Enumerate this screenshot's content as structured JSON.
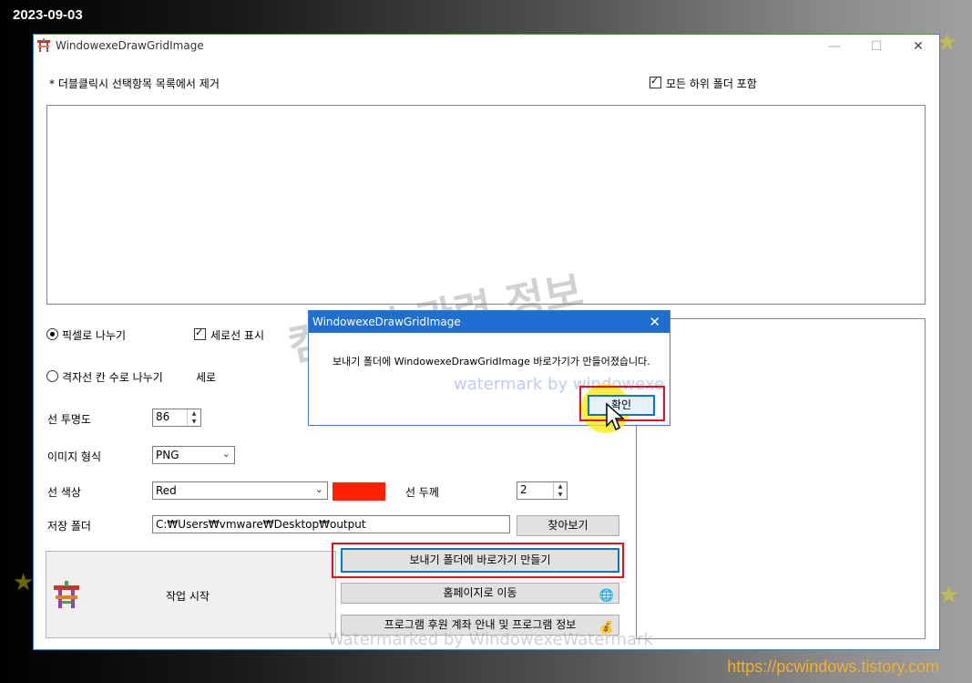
{
  "overlay": {
    "date": "2023-09-03",
    "blog_url": "https://pcwindows.tistory.com"
  },
  "window": {
    "title": "WindowexeDrawGridImage",
    "controls": [
      "minimize",
      "maximize",
      "close"
    ]
  },
  "main": {
    "hint": "* 더블클릭시 선택항목 목록에서 제거",
    "include_subfolders": {
      "label": "모든 하위 폴더 포함",
      "checked": true
    },
    "split_by_pixel": {
      "label": "픽셀로 나누기",
      "selected": true
    },
    "show_vertical_lines": {
      "label": "세로선 표시",
      "checked": true
    },
    "split_by_grid": {
      "label": "격자선 칸 수로 나누기",
      "selected": false
    },
    "vertical_label": "세로",
    "line_opacity": {
      "label": "선 투명도",
      "value": "86"
    },
    "image_format": {
      "label": "이미지 형식",
      "value": "PNG"
    },
    "line_color": {
      "label": "선 색상",
      "value": "Red",
      "swatch": "#ff2200"
    },
    "line_width": {
      "label": "선 두께",
      "value": "2"
    },
    "save_folder": {
      "label": "저장 폴더",
      "value": "C:₩Users₩vmware₩Desktop₩output",
      "browse_label": "찾아보기"
    },
    "start_label": "작업 시작",
    "shortcut_button": "보내기 폴더에 바로가기 만들기",
    "homepage_button": "홈페이지로 이동",
    "info_button": "프로그램 후원 계좌 안내 및 프로그램 정보"
  },
  "dialog": {
    "title": "WindowexeDrawGridImage",
    "message": "보내기 폴더에 WindowexeDrawGridImage 바로가기가 만들어졌습니다.",
    "ok_label": "확인"
  },
  "watermarks": {
    "korean": "컴퓨터 관련 정보",
    "english": "watermark by windowexe",
    "bottom": "Watermarked by WindowexeWatermark"
  },
  "colors": {
    "accent": "#1e6fd0",
    "highlight_box": "#e01020",
    "cursor_highlight": "#ffeb00"
  }
}
